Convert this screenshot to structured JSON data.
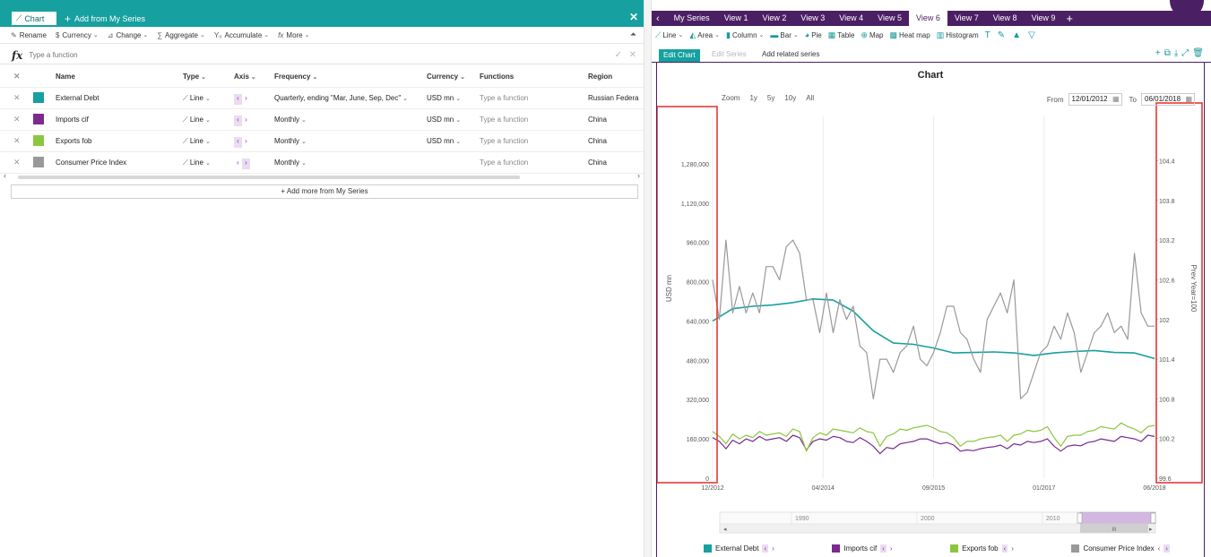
{
  "left_panel": {
    "tab_chart": "Chart",
    "tab_add": "Add from My Series",
    "toolbar": {
      "rename": "Rename",
      "currency": "Currency",
      "change": "Change",
      "aggregate": "Aggregate",
      "accumulate": "Accumulate",
      "more": "More"
    },
    "fx_placeholder": "Type a function",
    "table": {
      "headers": {
        "name": "Name",
        "type": "Type",
        "axis": "Axis",
        "frequency": "Frequency",
        "currency": "Currency",
        "functions": "Functions",
        "region": "Region"
      },
      "rows": [
        {
          "name": "External Debt",
          "color": "#16a0a0",
          "type": "Line",
          "frequency": "Quarterly, ending \"Mar, June, Sep, Dec\"",
          "currency": "USD mn",
          "function": "Type a function",
          "region": "Russian Federa",
          "axis": "left"
        },
        {
          "name": "Imports cif",
          "color": "#7b2a8f",
          "type": "Line",
          "frequency": "Monthly",
          "currency": "USD mn",
          "function": "Type a function",
          "region": "China",
          "axis": "left"
        },
        {
          "name": "Exports fob",
          "color": "#8cc63f",
          "type": "Line",
          "frequency": "Monthly",
          "currency": "USD mn",
          "function": "Type a function",
          "region": "China",
          "axis": "left"
        },
        {
          "name": "Consumer Price Index",
          "color": "#999999",
          "type": "Line",
          "frequency": "Monthly",
          "currency": "",
          "function": "Type a function",
          "region": "China",
          "axis": "right"
        }
      ]
    },
    "add_more": "+ Add more from My Series"
  },
  "right_panel": {
    "back_label": "My Series",
    "views": [
      "View 1",
      "View 2",
      "View 3",
      "View 4",
      "View 5",
      "View 6",
      "View 7",
      "View 8",
      "View 9"
    ],
    "active_view": "View 6",
    "chart_types": [
      "Line",
      "Area",
      "Column",
      "Bar",
      "Pie",
      "Table",
      "Map",
      "Heat map",
      "Histogram"
    ],
    "sub_tabs": {
      "edit_chart": "Edit Chart",
      "edit_series": "Edit Series",
      "add_related": "Add related series"
    },
    "zoom": {
      "label": "Zoom",
      "buttons": [
        "1y",
        "5y",
        "10y",
        "All"
      ]
    },
    "range": {
      "from_label": "From",
      "from": "12/01/2012",
      "to_label": "To",
      "to": "06/01/2018"
    },
    "navigator_labels": [
      "1990",
      "2000",
      "2010"
    ],
    "navigator_grip": "III"
  },
  "colors": {
    "teal": "#16a0a0",
    "purple": "#4b1f63",
    "imports": "#7b2a8f",
    "exports": "#8cc63f",
    "cpi": "#999999",
    "highlight": "#e53935"
  },
  "chart_data": {
    "type": "line",
    "title": "Chart",
    "ylabel": "USD mn",
    "y2label": "Prev Year=100",
    "x_tick_labels": [
      "12/2012",
      "04/2014",
      "09/2015",
      "01/2017",
      "06/2018"
    ],
    "ylim": [
      0,
      1400000
    ],
    "y_ticks": [
      "0",
      "160,000",
      "320,000",
      "480,000",
      "640,000",
      "800,000",
      "960,000",
      "1,120,000",
      "1,280,000"
    ],
    "y2lim": [
      99.6,
      104.8
    ],
    "y2_ticks": [
      "99.6",
      "100.2",
      "100.8",
      "101.4",
      "102",
      "102.6",
      "103.2",
      "103.8",
      "104.4"
    ],
    "grid": true,
    "legend_position": "bottom",
    "months": 67,
    "series": [
      {
        "name": "External Debt",
        "axis": "left",
        "points": [
          [
            0,
            640000
          ],
          [
            3,
            690000
          ],
          [
            6,
            700000
          ],
          [
            9,
            705000
          ],
          [
            12,
            715000
          ],
          [
            15,
            730000
          ],
          [
            18,
            725000
          ],
          [
            21,
            680000
          ],
          [
            24,
            600000
          ],
          [
            27,
            550000
          ],
          [
            30,
            545000
          ],
          [
            33,
            530000
          ],
          [
            36,
            510000
          ],
          [
            39,
            512000
          ],
          [
            42,
            514000
          ],
          [
            45,
            510000
          ],
          [
            48,
            500000
          ],
          [
            51,
            510000
          ],
          [
            54,
            516000
          ],
          [
            57,
            520000
          ],
          [
            60,
            512000
          ],
          [
            63,
            510000
          ],
          [
            66,
            487000
          ]
        ]
      },
      {
        "name": "Imports cif",
        "axis": "left",
        "values": [
          165000,
          150000,
          120000,
          155000,
          140000,
          160000,
          150000,
          170000,
          155000,
          160000,
          165000,
          150000,
          175000,
          165000,
          115000,
          150000,
          160000,
          155000,
          170000,
          165000,
          150000,
          145000,
          165000,
          150000,
          130000,
          100000,
          125000,
          120000,
          140000,
          145000,
          150000,
          160000,
          160000,
          150000,
          140000,
          145000,
          135000,
          110000,
          115000,
          112000,
          120000,
          125000,
          128000,
          135000,
          120000,
          140000,
          135000,
          150000,
          145000,
          150000,
          160000,
          130000,
          110000,
          130000,
          135000,
          132000,
          145000,
          150000,
          160000,
          155000,
          150000,
          170000,
          165000,
          160000,
          150000,
          175000,
          170000
        ]
      },
      {
        "name": "Exports fob",
        "axis": "left",
        "values": [
          190000,
          170000,
          140000,
          180000,
          160000,
          175000,
          165000,
          190000,
          175000,
          180000,
          185000,
          170000,
          200000,
          190000,
          110000,
          165000,
          185000,
          175000,
          200000,
          195000,
          190000,
          185000,
          205000,
          190000,
          185000,
          130000,
          170000,
          180000,
          200000,
          195000,
          205000,
          210000,
          215000,
          205000,
          190000,
          185000,
          165000,
          130000,
          150000,
          150000,
          160000,
          165000,
          168000,
          175000,
          150000,
          175000,
          180000,
          195000,
          190000,
          195000,
          210000,
          165000,
          130000,
          170000,
          175000,
          175000,
          190000,
          195000,
          210000,
          205000,
          200000,
          225000,
          210000,
          200000,
          185000,
          210000,
          215000
        ]
      },
      {
        "name": "Consumer Price Index",
        "axis": "right",
        "values": [
          102.6,
          102.0,
          103.2,
          102.1,
          102.5,
          102.1,
          102.4,
          102.1,
          102.8,
          102.8,
          102.6,
          103.1,
          103.2,
          103.0,
          102.3,
          102.3,
          101.8,
          102.4,
          101.8,
          102.3,
          102.0,
          102.2,
          101.6,
          101.5,
          100.8,
          101.4,
          101.4,
          101.2,
          101.5,
          101.6,
          101.9,
          101.4,
          101.3,
          101.5,
          101.8,
          102.2,
          102.2,
          101.8,
          101.7,
          101.4,
          101.2,
          102.0,
          102.2,
          102.4,
          102.1,
          102.6,
          100.8,
          100.9,
          101.2,
          101.5,
          101.6,
          101.9,
          101.7,
          102.1,
          101.8,
          101.2,
          101.5,
          101.8,
          101.9,
          102.1,
          101.8,
          101.9,
          101.7,
          103.0,
          102.1,
          101.9,
          101.9
        ]
      }
    ]
  }
}
